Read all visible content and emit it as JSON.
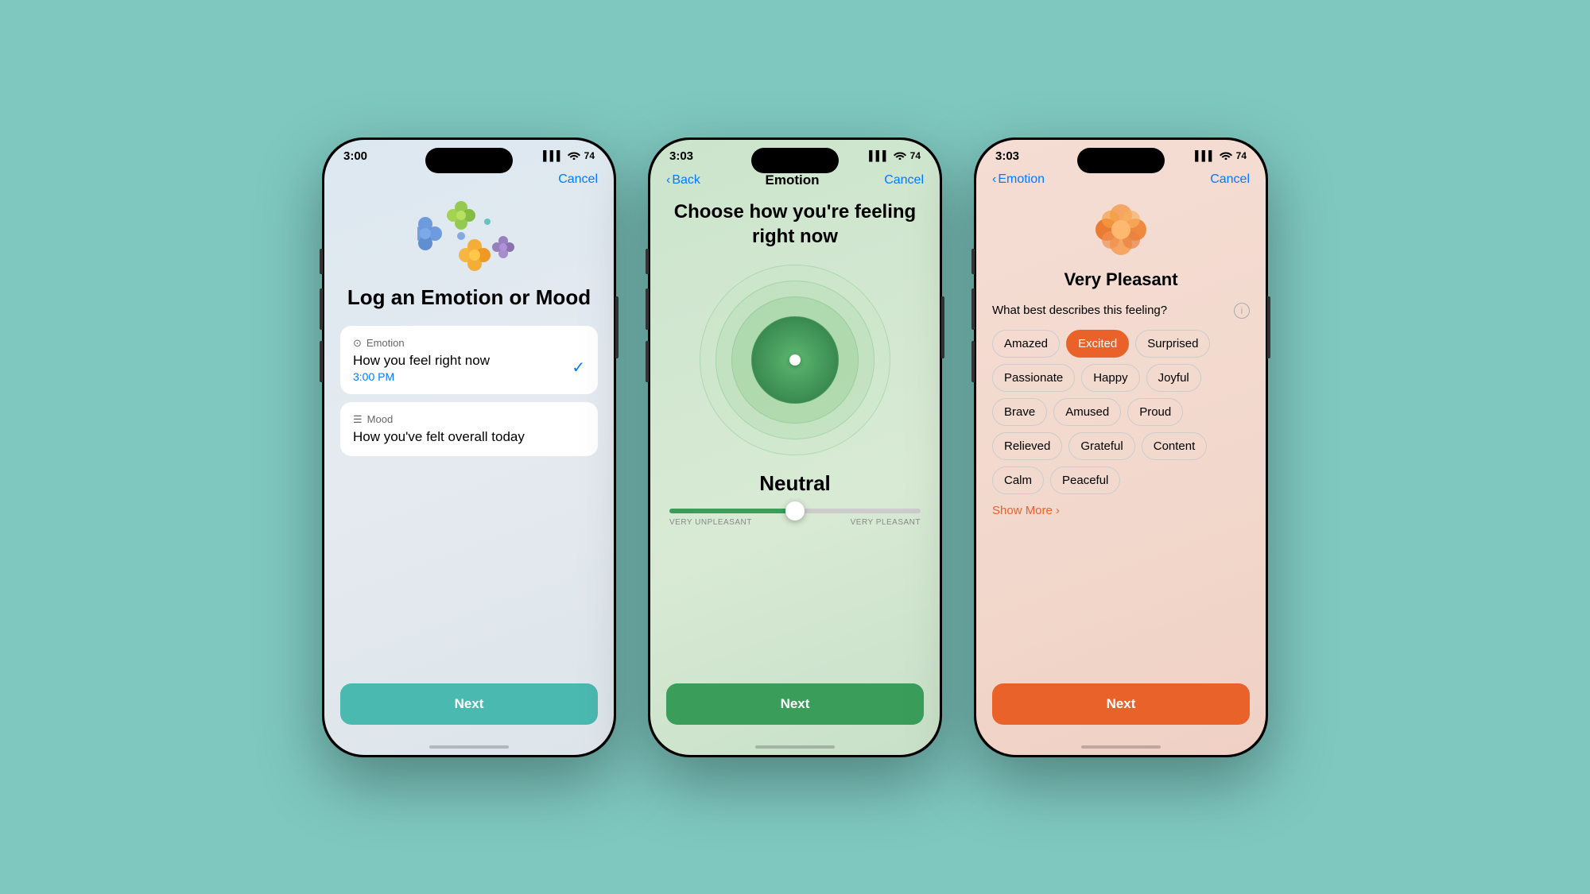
{
  "bg_color": "#7ec8c0",
  "phones": [
    {
      "id": "phone1",
      "screen_bg": "screen1",
      "status": {
        "time": "3:00",
        "location": "▲",
        "signal": "▌▌▌",
        "wifi": "WiFi",
        "battery": "74"
      },
      "nav": {
        "cancel": "Cancel"
      },
      "title": "Log an Emotion\nor Mood",
      "options": [
        {
          "icon": "⊙",
          "type": "Emotion",
          "description": "How you feel right now",
          "time": "3:00 PM",
          "selected": true
        },
        {
          "icon": "☰",
          "type": "Mood",
          "description": "How you've felt overall today",
          "time": null,
          "selected": false
        }
      ],
      "next_label": "Next"
    },
    {
      "id": "phone2",
      "screen_bg": "screen2",
      "status": {
        "time": "3:03",
        "location": "▲",
        "signal": "▌▌▌",
        "wifi": "WiFi",
        "battery": "74"
      },
      "nav": {
        "back": "Back",
        "title": "Emotion",
        "cancel": "Cancel"
      },
      "heading": "Choose how you're feeling\nright now",
      "emotion_label": "Neutral",
      "slider": {
        "left": "VERY UNPLEASANT",
        "right": "VERY PLEASANT",
        "position": 50
      },
      "next_label": "Next"
    },
    {
      "id": "phone3",
      "screen_bg": "screen3",
      "status": {
        "time": "3:03",
        "location": "▲",
        "signal": "▌▌▌",
        "wifi": "WiFi",
        "battery": "74"
      },
      "nav": {
        "back": "Emotion",
        "cancel": "Cancel"
      },
      "feeling_title": "Very Pleasant",
      "describe_label": "What best describes this feeling?",
      "tags": [
        {
          "label": "Amazed",
          "selected": false
        },
        {
          "label": "Excited",
          "selected": true
        },
        {
          "label": "Surprised",
          "selected": false
        },
        {
          "label": "Passionate",
          "selected": false
        },
        {
          "label": "Happy",
          "selected": false
        },
        {
          "label": "Joyful",
          "selected": false
        },
        {
          "label": "Brave",
          "selected": false
        },
        {
          "label": "Amused",
          "selected": false
        },
        {
          "label": "Proud",
          "selected": false
        },
        {
          "label": "Relieved",
          "selected": false
        },
        {
          "label": "Grateful",
          "selected": false
        },
        {
          "label": "Content",
          "selected": false
        },
        {
          "label": "Calm",
          "selected": false
        },
        {
          "label": "Peaceful",
          "selected": false
        }
      ],
      "show_more": "Show More",
      "next_label": "Next"
    }
  ]
}
